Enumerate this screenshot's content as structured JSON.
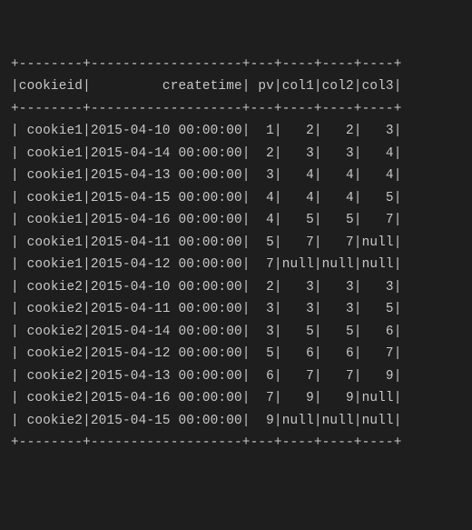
{
  "headers": {
    "cookieid": "cookieid",
    "createtime": "createtime",
    "pv": "pv",
    "col1": "col1",
    "col2": "col2",
    "col3": "col3"
  },
  "widths": {
    "cookieid": 8,
    "createtime": 19,
    "pv": 3,
    "col1": 4,
    "col2": 4,
    "col3": 4
  },
  "rows": [
    {
      "cookieid": "cookie1",
      "createtime": "2015-04-10 00:00:00",
      "pv": "1",
      "col1": "2",
      "col2": "2",
      "col3": "3"
    },
    {
      "cookieid": "cookie1",
      "createtime": "2015-04-14 00:00:00",
      "pv": "2",
      "col1": "3",
      "col2": "3",
      "col3": "4"
    },
    {
      "cookieid": "cookie1",
      "createtime": "2015-04-13 00:00:00",
      "pv": "3",
      "col1": "4",
      "col2": "4",
      "col3": "4"
    },
    {
      "cookieid": "cookie1",
      "createtime": "2015-04-15 00:00:00",
      "pv": "4",
      "col1": "4",
      "col2": "4",
      "col3": "5"
    },
    {
      "cookieid": "cookie1",
      "createtime": "2015-04-16 00:00:00",
      "pv": "4",
      "col1": "5",
      "col2": "5",
      "col3": "7"
    },
    {
      "cookieid": "cookie1",
      "createtime": "2015-04-11 00:00:00",
      "pv": "5",
      "col1": "7",
      "col2": "7",
      "col3": "null"
    },
    {
      "cookieid": "cookie1",
      "createtime": "2015-04-12 00:00:00",
      "pv": "7",
      "col1": "null",
      "col2": "null",
      "col3": "null"
    },
    {
      "cookieid": "cookie2",
      "createtime": "2015-04-10 00:00:00",
      "pv": "2",
      "col1": "3",
      "col2": "3",
      "col3": "3"
    },
    {
      "cookieid": "cookie2",
      "createtime": "2015-04-11 00:00:00",
      "pv": "3",
      "col1": "3",
      "col2": "3",
      "col3": "5"
    },
    {
      "cookieid": "cookie2",
      "createtime": "2015-04-14 00:00:00",
      "pv": "3",
      "col1": "5",
      "col2": "5",
      "col3": "6"
    },
    {
      "cookieid": "cookie2",
      "createtime": "2015-04-12 00:00:00",
      "pv": "5",
      "col1": "6",
      "col2": "6",
      "col3": "7"
    },
    {
      "cookieid": "cookie2",
      "createtime": "2015-04-13 00:00:00",
      "pv": "6",
      "col1": "7",
      "col2": "7",
      "col3": "9"
    },
    {
      "cookieid": "cookie2",
      "createtime": "2015-04-16 00:00:00",
      "pv": "7",
      "col1": "9",
      "col2": "9",
      "col3": "null"
    },
    {
      "cookieid": "cookie2",
      "createtime": "2015-04-15 00:00:00",
      "pv": "9",
      "col1": "null",
      "col2": "null",
      "col3": "null"
    }
  ]
}
